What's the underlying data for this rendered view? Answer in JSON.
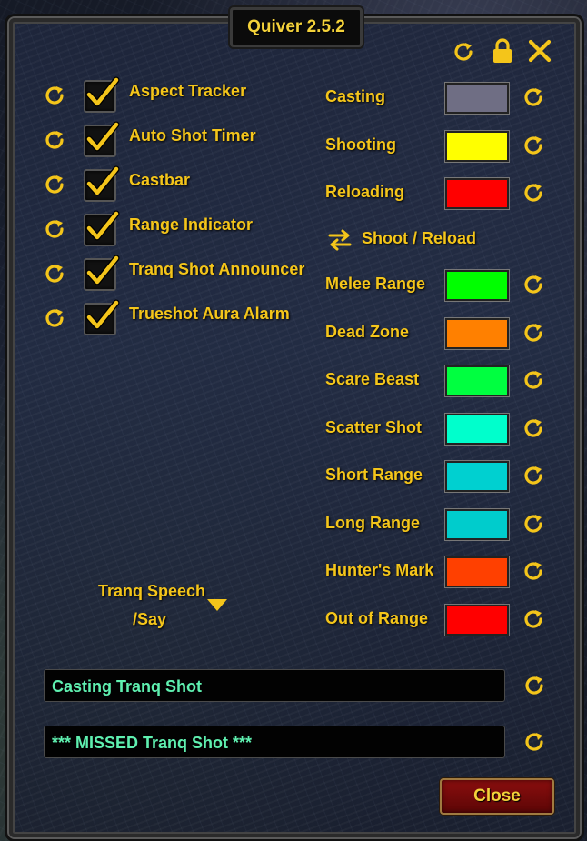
{
  "window": {
    "title": "Quiver 2.5.2"
  },
  "header_icons": [
    "reset-icon",
    "lock-icon",
    "close-icon"
  ],
  "modules": [
    {
      "label": "Aspect Tracker",
      "checked": true
    },
    {
      "label": "Auto Shot Timer",
      "checked": true
    },
    {
      "label": "Castbar",
      "checked": true
    },
    {
      "label": "Range Indicator",
      "checked": true
    },
    {
      "label": "Tranq Shot Announcer",
      "checked": true
    },
    {
      "label": "Trueshot Aura Alarm",
      "checked": true
    }
  ],
  "castbar_colors": [
    {
      "label": "Casting",
      "color": "#6f6e84"
    },
    {
      "label": "Shooting",
      "color": "#ffff00"
    },
    {
      "label": "Reloading",
      "color": "#ff0000"
    }
  ],
  "swap_label": "Shoot / Reload",
  "range_colors": [
    {
      "label": "Melee Range",
      "color": "#00ff00"
    },
    {
      "label": "Dead Zone",
      "color": "#ff8000"
    },
    {
      "label": "Scare Beast",
      "color": "#00ff40"
    },
    {
      "label": "Scatter Shot",
      "color": "#00ffcc"
    },
    {
      "label": "Short Range",
      "color": "#00d0d0"
    },
    {
      "label": "Long Range",
      "color": "#00cccc"
    },
    {
      "label": "Hunter's Mark",
      "color": "#ff4000"
    },
    {
      "label": "Out of Range",
      "color": "#ff0000"
    }
  ],
  "tranq_speech": {
    "label": "Tranq Speech",
    "selected": "/Say"
  },
  "messages": {
    "casting": "Casting Tranq Shot",
    "missed": "*** MISSED Tranq Shot ***"
  },
  "close_button": "Close",
  "accent_color": "#f4c51a"
}
